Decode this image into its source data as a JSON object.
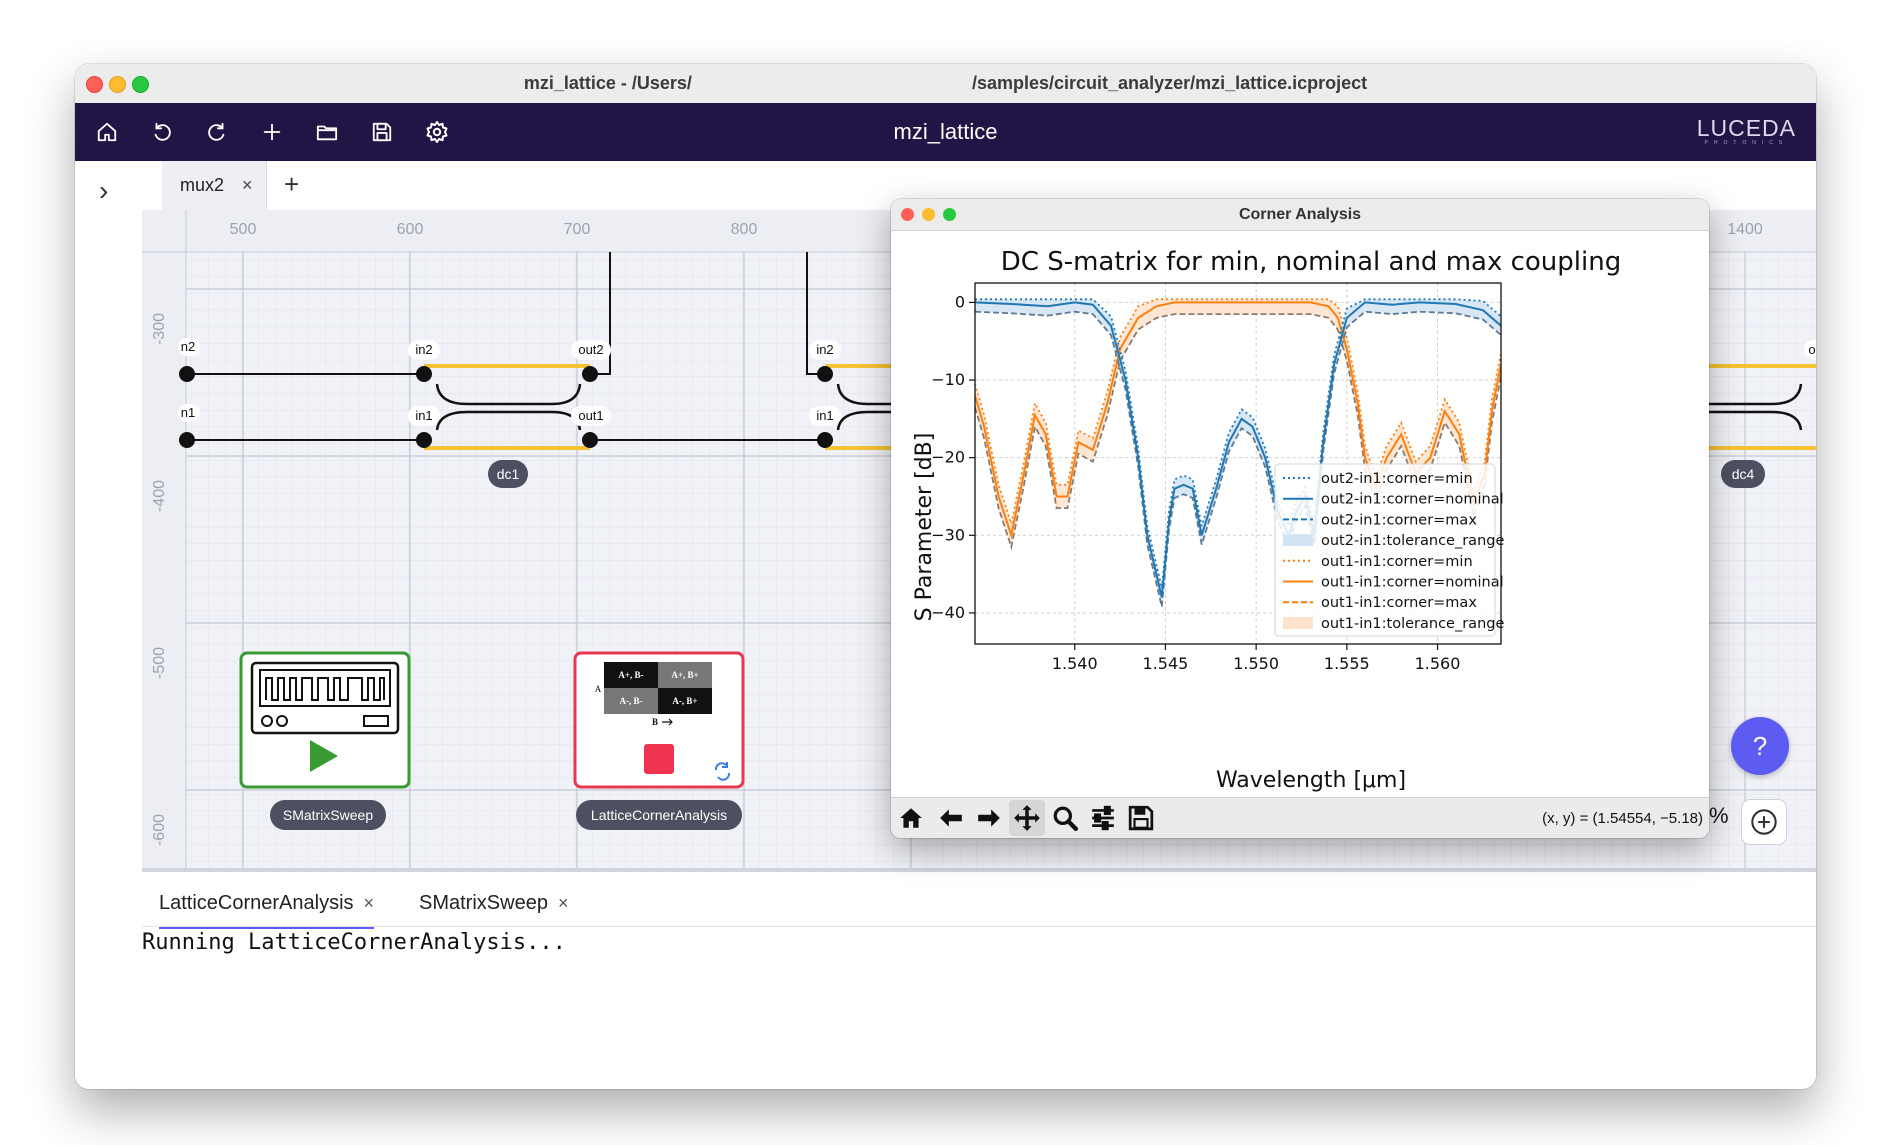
{
  "window": {
    "title": "mzi_lattice - /Users/                                                        /samples/circuit_analyzer/mzi_lattice.icproject"
  },
  "toolbar": {
    "title": "mzi_lattice",
    "logo": "LUCEDA",
    "logo_sub": "PHOTONICS"
  },
  "tabs": [
    {
      "label": "mux2",
      "close": "×"
    }
  ],
  "add_tab": "+",
  "expand": "›",
  "canvas": {
    "x_ticks": [
      "500",
      "600",
      "700",
      "800",
      "1400"
    ],
    "y_ticks": [
      "-300",
      "-400",
      "-500",
      "-600"
    ],
    "ports": {
      "in2_left": "n2",
      "in1_left": "n1",
      "dc1_in2": "in2",
      "dc1_out2": "out2",
      "dc1_in1": "in1",
      "dc1_out1": "out1",
      "dc2_in2": "in2",
      "dc2_in1": "in1",
      "dc4_o": "o"
    },
    "components": {
      "dc1": "dc1",
      "dc4": "dc4"
    },
    "sweep_block": {
      "label": "SMatrixSweep"
    },
    "corner_block": {
      "label": "LatticeCornerAnalysis",
      "cells": [
        "A+, B-",
        "A+, B+",
        "A-, B-",
        "A-, B+"
      ],
      "axis_a": "A",
      "axis_b": "B"
    }
  },
  "bottom": {
    "tabs": [
      {
        "label": "LatticeCornerAnalysis",
        "close": "×"
      },
      {
        "label": "SMatrixSweep",
        "close": "×"
      }
    ],
    "console": "Running LatticeCornerAnalysis..."
  },
  "corner_window": {
    "title": "Corner Analysis",
    "coords": "(x, y) = (1.54554, −5.18)"
  },
  "help_label": "?",
  "zoom_percent": "%",
  "chart_data": {
    "type": "line",
    "title": "DC S-matrix for min, nominal and max coupling",
    "xlabel": "Wavelength [μm]",
    "ylabel": "S Parameter [dB]",
    "xlim": [
      1.5345,
      1.5635
    ],
    "ylim": [
      -44,
      2.5
    ],
    "x_ticks": [
      1.54,
      1.545,
      1.55,
      1.555,
      1.56
    ],
    "x_tick_labels": [
      "1.540",
      "1.545",
      "1.550",
      "1.555",
      "1.560"
    ],
    "y_ticks": [
      0,
      -10,
      -20,
      -30,
      -40
    ],
    "y_tick_labels": [
      "0",
      "−10",
      "−20",
      "−30",
      "−40"
    ],
    "grid": true,
    "legend_position": "lower-right",
    "legend": [
      "out2-in1:corner=min",
      "out2-in1:corner=nominal",
      "out2-in1:corner=max",
      "out2-in1:tolerance_range",
      "out1-in1:corner=min",
      "out1-in1:corner=nominal",
      "out1-in1:corner=max",
      "out1-in1:tolerance_range"
    ],
    "colors": {
      "out2": "#1f77b4",
      "out1": "#ff7f0e",
      "out2_fill": "#d2e3f3",
      "out1_fill": "#fde3cc"
    },
    "series": [
      {
        "name": "out2-in1:corner=nominal",
        "x": [
          1.5345,
          1.5365,
          1.5385,
          1.54,
          1.541,
          1.542,
          1.5428,
          1.5435,
          1.544,
          1.5448,
          1.5452,
          1.5455,
          1.546,
          1.5465,
          1.547,
          1.5478,
          1.5485,
          1.5492,
          1.5498,
          1.5505,
          1.5512,
          1.5518,
          1.5522,
          1.5527,
          1.5532,
          1.5537,
          1.5543,
          1.555,
          1.556,
          1.5575,
          1.559,
          1.561,
          1.5625,
          1.5635
        ],
        "values": [
          0,
          -0.2,
          -0.5,
          0,
          -0.3,
          -3,
          -10,
          -20,
          -30,
          -38,
          -28,
          -24,
          -23.5,
          -24,
          -30,
          -24,
          -18,
          -15,
          -16,
          -20,
          -27,
          -30,
          -27,
          -25,
          -30,
          -18,
          -8,
          -2,
          0,
          -0.3,
          0,
          -0.2,
          -1,
          -3
        ]
      },
      {
        "name": "out1-in1:corner=nominal",
        "x": [
          1.5345,
          1.535,
          1.5358,
          1.5365,
          1.5372,
          1.5378,
          1.5384,
          1.539,
          1.5396,
          1.5402,
          1.541,
          1.5418,
          1.5425,
          1.5435,
          1.5445,
          1.5455,
          1.547,
          1.55,
          1.553,
          1.554,
          1.5545,
          1.555,
          1.5556,
          1.556,
          1.5566,
          1.5572,
          1.558,
          1.5588,
          1.5596,
          1.5604,
          1.5612,
          1.562,
          1.5626,
          1.563,
          1.5635
        ],
        "values": [
          -12,
          -16,
          -25,
          -30,
          -22,
          -14.5,
          -17,
          -25,
          -25,
          -18,
          -19,
          -13,
          -6,
          -2,
          -0.5,
          0,
          0,
          0,
          0,
          -0.5,
          -2,
          -6,
          -13,
          -20,
          -24,
          -20,
          -17,
          -22,
          -20,
          -14,
          -17,
          -26,
          -22,
          -14,
          -8
        ]
      }
    ]
  }
}
